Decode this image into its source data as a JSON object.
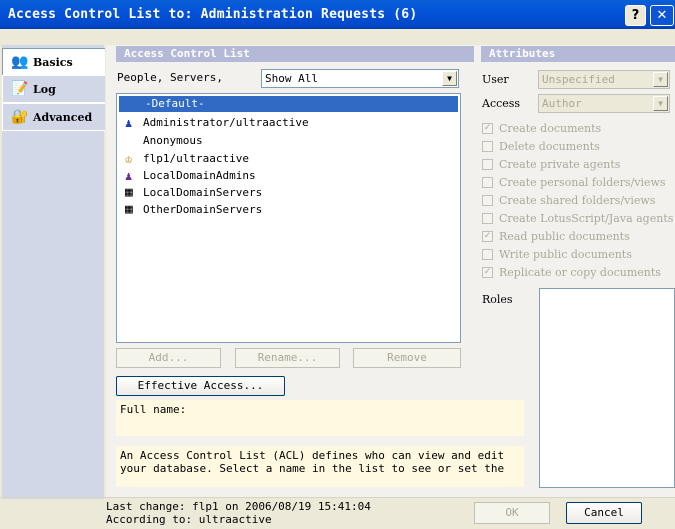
{
  "window": {
    "title": "Access Control List to: Administration Requests (6)",
    "help_glyph": "?",
    "close_glyph": "✕"
  },
  "tabs": [
    {
      "label": "Basics",
      "icon": "people-icon",
      "glyph": "👥"
    },
    {
      "label": "Log",
      "icon": "log-icon",
      "glyph": "📝"
    },
    {
      "label": "Advanced",
      "icon": "advanced-icon",
      "glyph": "🔐"
    }
  ],
  "acl": {
    "header": "Access Control List",
    "filter_label": "People, Servers,",
    "filter_value": "Show All",
    "entries": [
      {
        "name": "-Default-",
        "icon": "",
        "selected": true
      },
      {
        "name": "Administrator/ultraactive",
        "icon": "person-icon"
      },
      {
        "name": "Anonymous",
        "icon": ""
      },
      {
        "name": "flp1/ultraactive",
        "icon": "key-person-icon"
      },
      {
        "name": "LocalDomainAdmins",
        "icon": "group-icon"
      },
      {
        "name": "LocalDomainServers",
        "icon": "server-group-icon"
      },
      {
        "name": "OtherDomainServers",
        "icon": "server-group-icon"
      }
    ],
    "add_label": "Add...",
    "rename_label": "Rename...",
    "remove_label": "Remove",
    "effective_access_label": "Effective Access...",
    "full_name_label": "Full name:",
    "description": "An Access Control List (ACL) defines who can view and edit your database.  Select a name in the list to see or set the"
  },
  "attributes": {
    "header": "Attributes",
    "user_label": "User",
    "user_value": "Unspecified",
    "access_label": "Access",
    "access_value": "Author",
    "options": [
      {
        "label": "Create documents",
        "checked": true
      },
      {
        "label": "Delete documents",
        "checked": false
      },
      {
        "label": "Create private agents",
        "checked": false
      },
      {
        "label": "Create personal folders/views",
        "checked": false
      },
      {
        "label": "Create shared folders/views",
        "checked": false
      },
      {
        "label": "Create LotusScript/Java agents",
        "checked": false
      },
      {
        "label": "Read public documents",
        "checked": true
      },
      {
        "label": "Write public documents",
        "checked": false
      },
      {
        "label": "Replicate or copy documents",
        "checked": true
      }
    ],
    "roles_label": "Roles"
  },
  "footer": {
    "last_change": "Last change: flp1 on 2006/08/19 15:41:04",
    "according_to": "According to: ultraactive",
    "ok_label": "OK",
    "cancel_label": "Cancel"
  }
}
